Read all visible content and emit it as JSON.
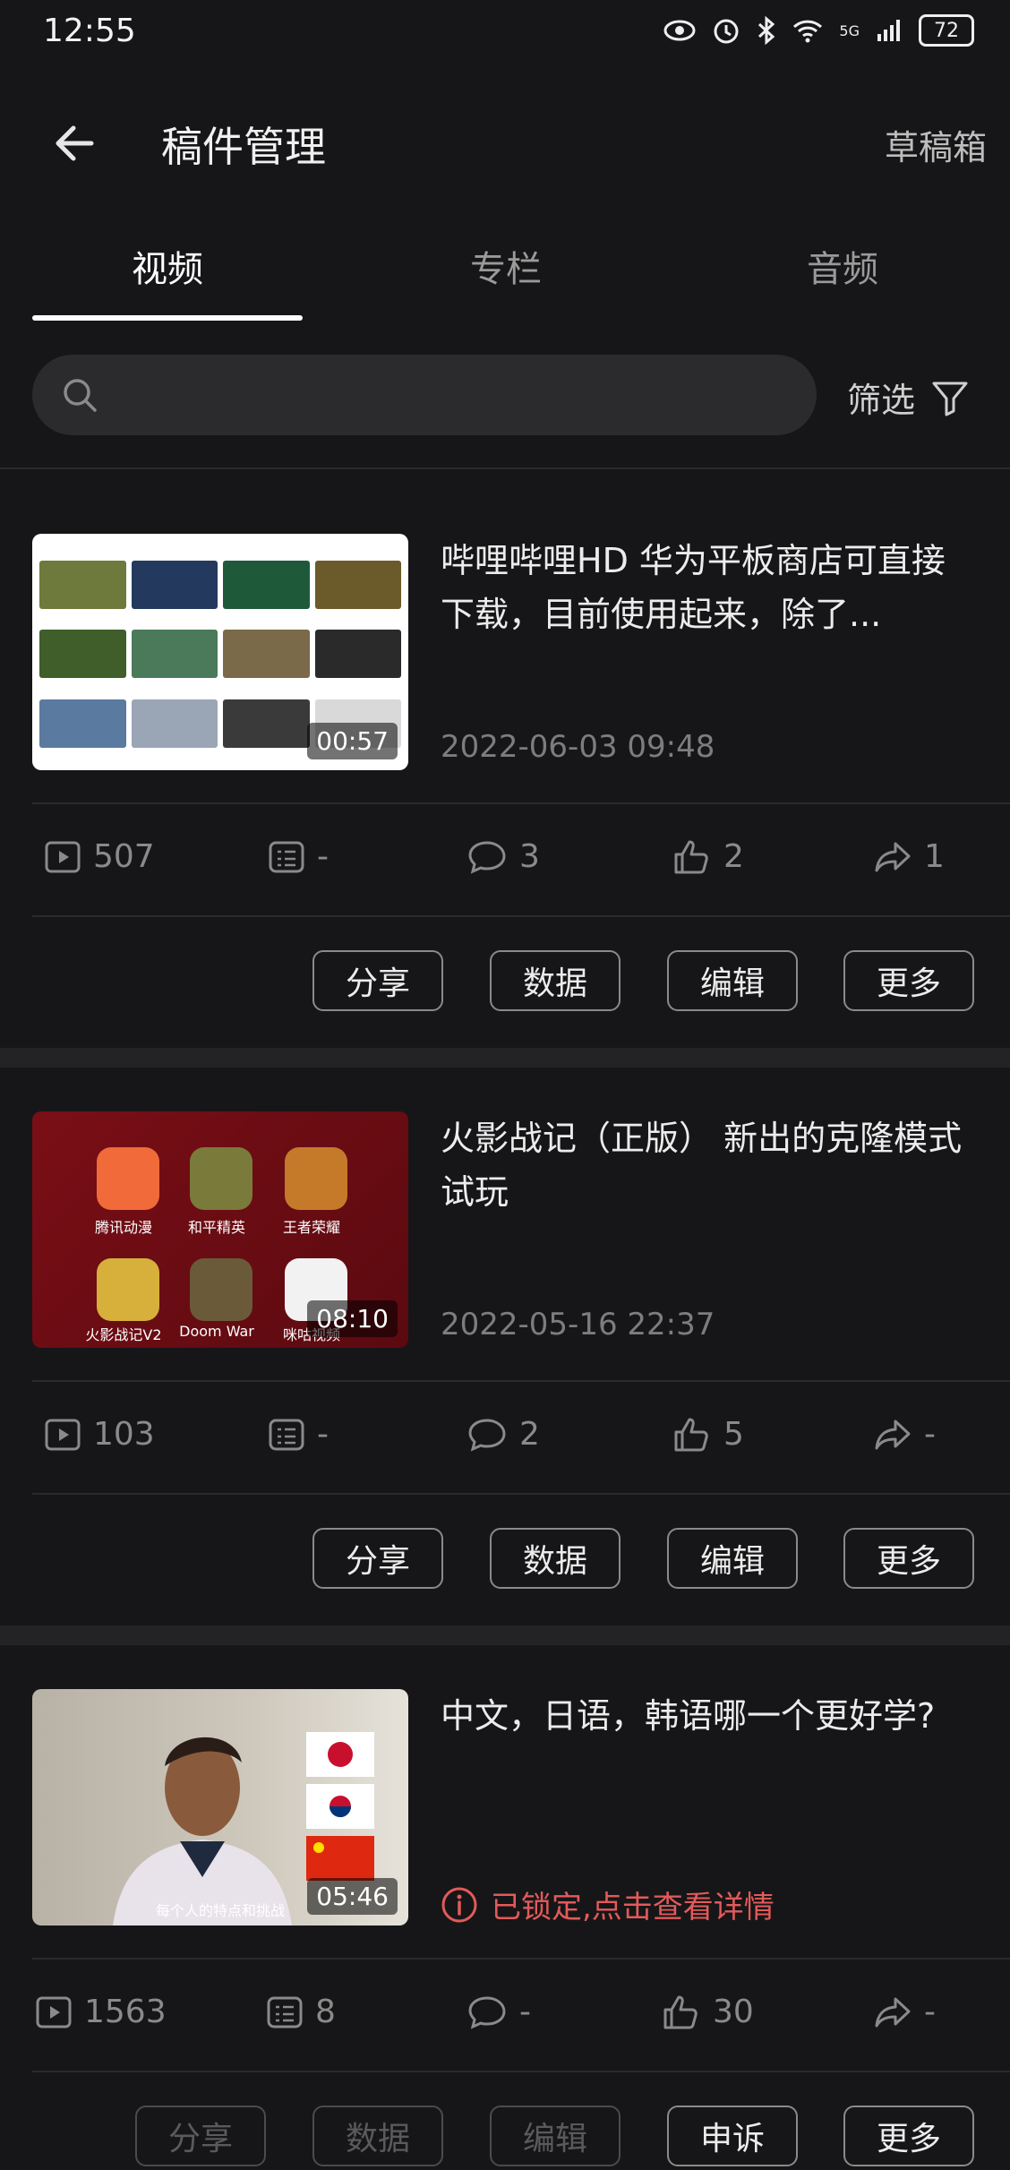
{
  "status": {
    "time": "12:55",
    "battery": "72",
    "network": "5G"
  },
  "header": {
    "title": "稿件管理",
    "drafts": "草稿箱"
  },
  "tabs": [
    {
      "label": "视频"
    },
    {
      "label": "专栏"
    },
    {
      "label": "音频"
    }
  ],
  "search": {
    "placeholder": "",
    "filter_label": "筛选"
  },
  "videos": [
    {
      "title": "哔哩哔哩HD 华为平板商店可直接下载，目前使用起来，除了...",
      "date": "2022-06-03 09:48",
      "duration": "00:57",
      "views": "507",
      "danmaku": "-",
      "comments": "3",
      "likes": "2",
      "shares": "1",
      "actions": [
        "分享",
        "数据",
        "编辑",
        "更多"
      ]
    },
    {
      "title": "火影战记（正版） 新出的克隆模式 试玩",
      "date": "2022-05-16 22:37",
      "duration": "08:10",
      "thumb_apps": [
        "腾讯动漫",
        "和平精英",
        "王者荣耀",
        "火影战记V2",
        "Doom War",
        "咪咕视频"
      ],
      "views": "103",
      "danmaku": "-",
      "comments": "2",
      "likes": "5",
      "shares": "-",
      "actions": [
        "分享",
        "数据",
        "编辑",
        "更多"
      ]
    },
    {
      "title": "中文，日语，韩语哪一个更好学?",
      "locked": "已锁定,点击查看详情",
      "duration": "05:46",
      "caption": "每个人的特点和挑战",
      "views": "1563",
      "danmaku": "8",
      "comments": "-",
      "likes": "30",
      "shares": "-",
      "actions": [
        "分享",
        "数据",
        "编辑",
        "申诉",
        "更多"
      ]
    }
  ]
}
